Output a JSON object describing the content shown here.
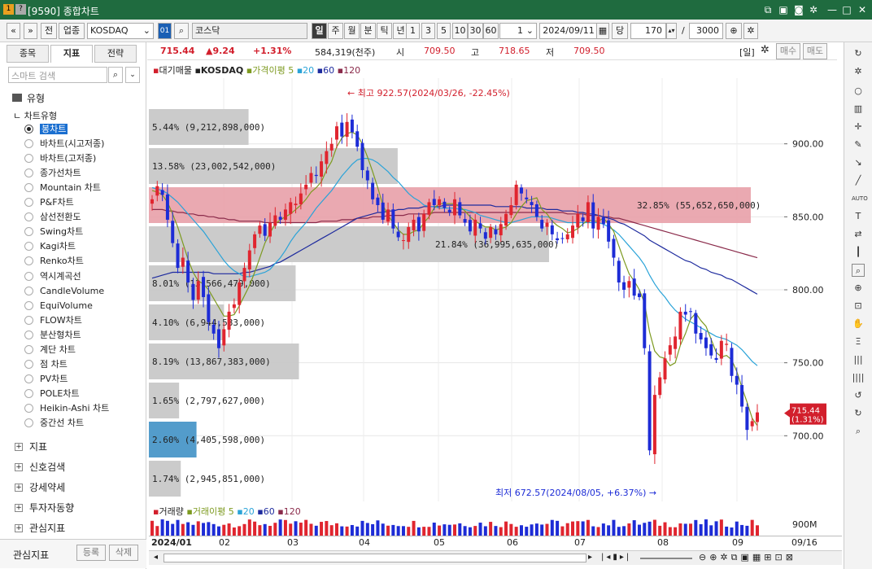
{
  "window": {
    "title": "[9590] 종합차트",
    "badge1": "1",
    "badge2": "?"
  },
  "toolbar": {
    "nav_prev": "«",
    "nav_menu": "»",
    "jeon": "전",
    "category": "업종",
    "symbol": "KOSDAQ",
    "code_badge": "01",
    "name": "코스닥",
    "periods": [
      "일",
      "주",
      "월",
      "분",
      "틱",
      "년"
    ],
    "active_period": "일",
    "intervals": [
      "1",
      "3",
      "5",
      "10",
      "30",
      "60"
    ],
    "unit_value": "1",
    "date": "2024/09/11",
    "dang_label": "당",
    "count": "170",
    "slash": "/",
    "total": "3000"
  },
  "left": {
    "tabs": [
      "종목",
      "지표",
      "전략"
    ],
    "active_tab": "지표",
    "search_placeholder": "스마트 검색",
    "section": "유형",
    "subsection": "차트유형",
    "chart_types": [
      "봉차트",
      "바차트(시고저종)",
      "바차트(고저종)",
      "종가선차트",
      "Mountain 차트",
      "P&F차트",
      "삼선전환도",
      "Swing차트",
      "Kagi차트",
      "Renko차트",
      "역시계곡선",
      "CandleVolume",
      "EquiVolume",
      "FLOW차트",
      "분산형차트",
      "계단 차트",
      "점 차트",
      "PV차트",
      "POLE차트",
      "Heikin-Ashi 차트",
      "중간선 차트"
    ],
    "groups": [
      "지표",
      "신호검색",
      "강세약세",
      "투자자동향",
      "관심지표"
    ],
    "bottom_label": "관심지표",
    "register": "등록",
    "delete": "삭제"
  },
  "info": {
    "price": "715.44",
    "change": "▲9.24",
    "pct": "+1.31%",
    "volume": "584,319(천주)",
    "open_label": "시",
    "open": "709.50",
    "high_label": "고",
    "high": "718.65",
    "low_label": "저",
    "low": "709.50",
    "freq": "[일]",
    "buy": "매수",
    "sell": "매도"
  },
  "legend": {
    "title": "대기매물",
    "symbol": "KOSDAQ",
    "ma_label": "가격이평",
    "ma": [
      "5",
      "20",
      "60",
      "120"
    ]
  },
  "vol_legend": {
    "title": "거래량",
    "ma_label": "거래이평",
    "ma": [
      "5",
      "20",
      "60",
      "120"
    ]
  },
  "colors": {
    "up": "#e0252f",
    "down": "#1d2cd6",
    "ma5": "#7d9a20",
    "ma20": "#2aa3d8",
    "ma60": "#1e2b9e",
    "ma120": "#8a2a4a",
    "title_bar": "#1f6b3f",
    "active_label": "#1a6fd0"
  },
  "chart_data": {
    "type": "candlestick",
    "ylim": [
      655,
      945
    ],
    "yticks": [
      "900.00",
      "850.00",
      "800.00",
      "750.00",
      "700.00"
    ],
    "x_labels": [
      "2024/01",
      "02",
      "03",
      "04",
      "05",
      "06",
      "07",
      "08",
      "09",
      "09/16"
    ],
    "current": {
      "price": "715.44",
      "pct": "(1.31%)"
    },
    "max_annotation": "최고 922.57(2024/03/26, -22.45%)",
    "min_annotation": "최저 672.57(2024/08/05, +6.37%)",
    "volume_axis_label": "900M",
    "close": [
      862,
      871,
      865,
      848,
      832,
      815,
      822,
      805,
      793,
      806,
      795,
      778,
      770,
      760,
      773,
      785,
      790,
      805,
      815,
      827,
      838,
      844,
      837,
      846,
      851,
      848,
      855,
      860,
      859,
      866,
      872,
      880,
      878,
      888,
      895,
      900,
      912,
      905,
      915,
      908,
      898,
      882,
      875,
      862,
      858,
      848,
      855,
      842,
      836,
      834,
      843,
      848,
      840,
      852,
      860,
      858,
      862,
      856,
      853,
      862,
      851,
      846,
      840,
      848,
      842,
      835,
      843,
      838,
      845,
      852,
      858,
      872,
      866,
      862,
      858,
      850,
      842,
      846,
      838,
      834,
      835,
      838,
      844,
      852,
      847,
      860,
      842,
      850,
      845,
      833,
      822,
      805,
      800,
      806,
      796,
      795,
      760,
      690,
      728,
      740,
      753,
      762,
      768,
      785,
      783,
      785,
      770,
      766,
      760,
      755,
      752,
      765,
      763,
      741,
      735,
      720,
      704,
      710,
      716
    ],
    "ma5": [
      868,
      867,
      865,
      860,
      852,
      843,
      832,
      821,
      812,
      806,
      804,
      800,
      794,
      788,
      782,
      782,
      783,
      789,
      796,
      803,
      812,
      822,
      832,
      839,
      845,
      848,
      850,
      852,
      855,
      858,
      862,
      867,
      870,
      874,
      882,
      888,
      898,
      904,
      907,
      908,
      906,
      900,
      891,
      881,
      870,
      858,
      851,
      846,
      841,
      838,
      838,
      840,
      841,
      846,
      850,
      856,
      859,
      859,
      859,
      859,
      857,
      854,
      850,
      847,
      845,
      843,
      843,
      841,
      842,
      843,
      846,
      852,
      857,
      861,
      862,
      863,
      855,
      852,
      847,
      844,
      842,
      839,
      840,
      842,
      845,
      848,
      847,
      847,
      849,
      845,
      840,
      830,
      820,
      811,
      806,
      800,
      791,
      771,
      758,
      754,
      753,
      748,
      750,
      762,
      770,
      780,
      784,
      779,
      775,
      766,
      757,
      754,
      755,
      752,
      744,
      733,
      723,
      712,
      707
    ],
    "ma20": [
      870,
      869,
      868,
      866,
      863,
      860,
      856,
      852,
      848,
      844,
      840,
      835,
      830,
      825,
      820,
      816,
      813,
      811,
      809,
      809,
      810,
      811,
      812,
      814,
      818,
      822,
      827,
      833,
      838,
      842,
      846,
      851,
      856,
      860,
      864,
      868,
      873,
      878,
      882,
      886,
      889,
      890,
      890,
      889,
      887,
      884,
      881,
      877,
      874,
      870,
      866,
      863,
      861,
      858,
      857,
      857,
      856,
      856,
      856,
      856,
      855,
      855,
      854,
      853,
      851,
      850,
      849,
      848,
      847,
      846,
      846,
      847,
      848,
      849,
      850,
      850,
      850,
      850,
      849,
      848,
      847,
      846,
      846,
      846,
      846,
      846,
      846,
      846,
      845,
      843,
      841,
      838,
      834,
      830,
      826,
      822,
      817,
      810,
      804,
      799,
      795,
      790,
      786,
      783,
      780,
      778,
      776,
      774,
      772,
      770,
      768,
      767,
      766,
      764,
      762,
      759,
      755,
      751,
      748
    ],
    "ma60": [
      808,
      809,
      810,
      811,
      812,
      812,
      812,
      812,
      812,
      812,
      812,
      812,
      811,
      811,
      811,
      811,
      811,
      811,
      812,
      812,
      813,
      814,
      815,
      816,
      818,
      819,
      821,
      823,
      825,
      827,
      829,
      831,
      833,
      835,
      837,
      839,
      841,
      843,
      845,
      847,
      849,
      850,
      851,
      852,
      853,
      853,
      854,
      854,
      855,
      855,
      856,
      856,
      856,
      857,
      857,
      857,
      857,
      858,
      858,
      858,
      858,
      858,
      858,
      858,
      858,
      858,
      858,
      857,
      857,
      857,
      857,
      857,
      857,
      856,
      856,
      856,
      856,
      855,
      855,
      855,
      854,
      854,
      854,
      853,
      853,
      852,
      852,
      851,
      850,
      849,
      848,
      846,
      845,
      843,
      841,
      839,
      837,
      834,
      832,
      830,
      828,
      826,
      824,
      822,
      820,
      819,
      817,
      815,
      814,
      812,
      811,
      810,
      808,
      807,
      805,
      803,
      801,
      799,
      797
    ],
    "ma120": [
      855,
      855,
      855,
      854,
      854,
      853,
      853,
      852,
      852,
      851,
      851,
      850,
      850,
      849,
      849,
      848,
      848,
      847,
      847,
      847,
      847,
      847,
      846,
      846,
      846,
      846,
      846,
      846,
      846,
      846,
      846,
      846,
      846,
      847,
      847,
      847,
      847,
      848,
      848,
      848,
      849,
      849,
      849,
      850,
      850,
      850,
      851,
      851,
      851,
      851,
      852,
      852,
      852,
      852,
      852,
      853,
      853,
      853,
      853,
      853,
      853,
      853,
      853,
      853,
      853,
      853,
      853,
      853,
      853,
      853,
      853,
      853,
      853,
      853,
      853,
      853,
      853,
      853,
      853,
      853,
      853,
      852,
      852,
      852,
      852,
      851,
      851,
      851,
      850,
      850,
      849,
      849,
      848,
      847,
      846,
      845,
      844,
      843,
      842,
      841,
      840,
      839,
      838,
      837,
      836,
      835,
      834,
      833,
      832,
      831,
      830,
      829,
      828,
      827,
      826,
      825,
      824,
      823,
      822
    ],
    "volume_profile": [
      {
        "label": "5.44% (9,212,898,000)",
        "share": 5.44,
        "highlight": false
      },
      {
        "label": "13.58% (23,002,542,000)",
        "share": 13.58,
        "highlight": false
      },
      {
        "label": "32.85% (55,652,650,000)",
        "share": 32.85,
        "highlight": true
      },
      {
        "label": "21.84% (36,995,635,000)",
        "share": 21.84,
        "highlight": false
      },
      {
        "label": "8.01% (13,566,479,000)",
        "share": 8.01,
        "highlight": false
      },
      {
        "label": "4.10% (6,944,583,000)",
        "share": 4.1,
        "highlight": false
      },
      {
        "label": "8.19% (13,867,383,000)",
        "share": 8.19,
        "highlight": false
      },
      {
        "label": "1.65% (2,797,627,000)",
        "share": 1.65,
        "highlight": false
      },
      {
        "label": "2.60% (4,405,598,000)",
        "share": 2.6,
        "highlight": false,
        "current": true
      },
      {
        "label": "1.74% (2,945,851,000)",
        "share": 1.74,
        "highlight": false
      }
    ]
  }
}
